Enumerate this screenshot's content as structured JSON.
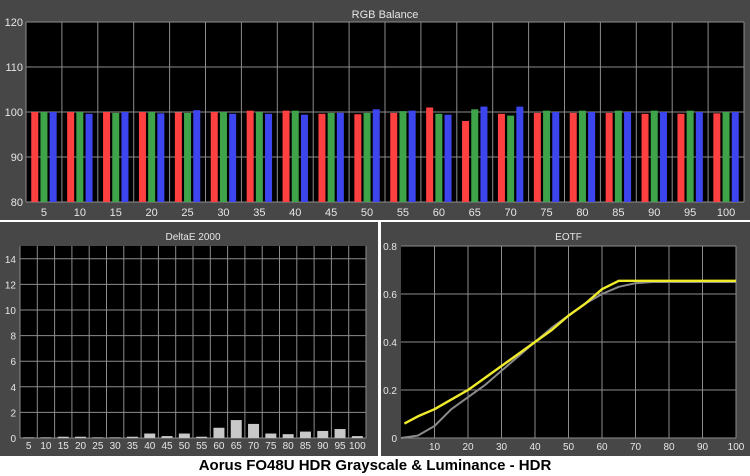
{
  "caption": "Aorus FO48U HDR Grayscale & Luminance - HDR",
  "colors": {
    "panel_bg": "#474747",
    "plot_bg": "#000000",
    "grid": "#8c8c8c",
    "text": "#e6e6e6",
    "red": "#ff4040",
    "green": "#3fa34a",
    "blue": "#3d46ee",
    "delta_bar": "#c8c8c8",
    "eotf_measured": "#f0ec2c",
    "eotf_target": "#8a8a8a"
  },
  "chart_data": [
    {
      "type": "bar",
      "title": "RGB Balance",
      "categories": [
        "5",
        "10",
        "15",
        "20",
        "25",
        "30",
        "35",
        "40",
        "45",
        "50",
        "55",
        "60",
        "65",
        "70",
        "75",
        "80",
        "85",
        "90",
        "95",
        "100"
      ],
      "ylim": [
        80,
        120
      ],
      "yticks": [
        80,
        90,
        100,
        110,
        120
      ],
      "grid": true,
      "series": [
        {
          "color": "red",
          "values": [
            100,
            100,
            100,
            100,
            99.9,
            100,
            100.3,
            100.3,
            99.6,
            99.5,
            99.8,
            101.0,
            98.0,
            99.6,
            99.8,
            99.8,
            99.8,
            99.6,
            99.6,
            99.7
          ]
        },
        {
          "color": "green",
          "values": [
            100,
            100,
            99.8,
            100,
            99.8,
            100,
            100,
            100.3,
            99.8,
            99.8,
            100.2,
            99.6,
            100.6,
            99.2,
            100.3,
            100.3,
            100.3,
            100.3,
            100.3,
            100
          ]
        },
        {
          "color": "blue",
          "values": [
            100,
            99.6,
            100,
            99.7,
            100.4,
            99.6,
            99.6,
            99.4,
            99.8,
            100.6,
            100.3,
            99.4,
            101.2,
            101.2,
            100,
            100,
            100,
            100,
            100,
            100
          ]
        }
      ]
    },
    {
      "type": "bar",
      "title": "DeltaE 2000",
      "categories": [
        "5",
        "10",
        "15",
        "20",
        "25",
        "30",
        "35",
        "40",
        "45",
        "50",
        "55",
        "60",
        "65",
        "70",
        "75",
        "80",
        "85",
        "90",
        "95",
        "100"
      ],
      "ylim": [
        0,
        15
      ],
      "yticks": [
        0,
        2,
        4,
        6,
        8,
        10,
        12,
        14
      ],
      "grid": true,
      "series": [
        {
          "values": [
            0.05,
            0.05,
            0.1,
            0.1,
            0.05,
            0.05,
            0.1,
            0.35,
            0.15,
            0.35,
            0.1,
            0.8,
            1.4,
            1.1,
            0.35,
            0.3,
            0.5,
            0.55,
            0.7,
            0.15
          ]
        }
      ]
    },
    {
      "type": "line",
      "title": "EOTF",
      "xlim": [
        0,
        100
      ],
      "ylim": [
        0,
        0.8
      ],
      "xticks": [
        10,
        20,
        30,
        40,
        50,
        60,
        70,
        80,
        90,
        100
      ],
      "yticks": [
        0,
        0.2,
        0.4,
        0.6,
        0.8
      ],
      "grid": true,
      "series": [
        {
          "color": "eotf_target",
          "x": [
            0,
            5,
            10,
            15,
            20,
            25,
            30,
            35,
            40,
            45,
            50,
            55,
            60,
            65,
            70,
            75,
            80,
            85,
            90,
            95,
            100
          ],
          "y": [
            0.0,
            0.01,
            0.05,
            0.12,
            0.17,
            0.22,
            0.28,
            0.34,
            0.4,
            0.46,
            0.51,
            0.56,
            0.6,
            0.63,
            0.645,
            0.65,
            0.65,
            0.65,
            0.65,
            0.65,
            0.65
          ]
        },
        {
          "color": "eotf_measured",
          "x": [
            1,
            5,
            10,
            15,
            20,
            25,
            30,
            35,
            40,
            45,
            50,
            55,
            60,
            65,
            70,
            75,
            80,
            85,
            90,
            95,
            100
          ],
          "y": [
            0.06,
            0.09,
            0.12,
            0.16,
            0.2,
            0.25,
            0.3,
            0.35,
            0.4,
            0.45,
            0.51,
            0.56,
            0.62,
            0.655,
            0.655,
            0.655,
            0.655,
            0.655,
            0.655,
            0.655,
            0.655
          ]
        }
      ]
    }
  ]
}
